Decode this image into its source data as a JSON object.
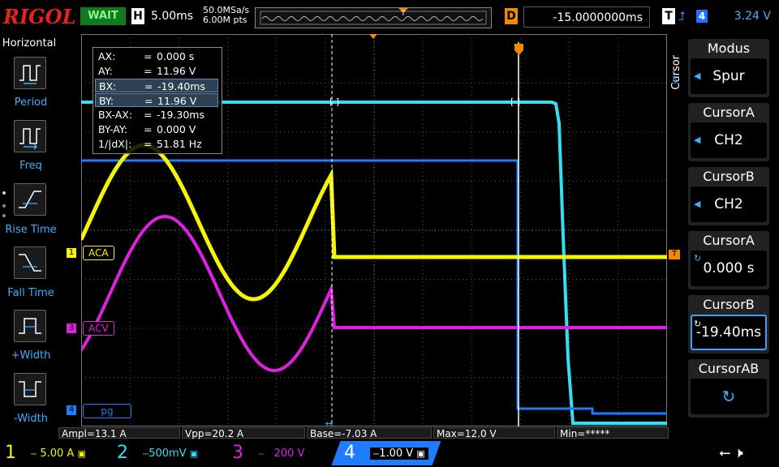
{
  "header": {
    "logo": "RIGOL",
    "run_state": "WAIT",
    "h_label": "H",
    "h_timebase": "5.00ms",
    "sample_rate": "50.0MSa/s",
    "memory_depth": "6.00M pts",
    "d_label": "D",
    "delay": "-15.0000000ms",
    "t_label": "T",
    "trigger_source": "4",
    "trigger_level": "3.24 V"
  },
  "left_menu": {
    "title": "Horizontal",
    "items": [
      {
        "label": "Period"
      },
      {
        "label": "Freq"
      },
      {
        "label": "Rise Time"
      },
      {
        "label": "Fall Time"
      },
      {
        "label": "+Width"
      },
      {
        "label": "-Width"
      }
    ]
  },
  "cursor_info": {
    "rows": [
      {
        "k": "AX:",
        "v": "0.000 s",
        "hl": false
      },
      {
        "k": "AY:",
        "v": "11.96 V",
        "hl": false
      },
      {
        "k": "BX:",
        "v": "-19.40ms",
        "hl": true
      },
      {
        "k": "BY:",
        "v": "11.96 V",
        "hl": true
      },
      {
        "k": "BX-AX:",
        "v": "-19.30ms",
        "hl": false
      },
      {
        "k": "BY-AY:",
        "v": "0.000 V",
        "hl": false
      },
      {
        "k": "1/|dX|:",
        "v": "51.81 Hz",
        "hl": false
      }
    ],
    "eq": "="
  },
  "channel_labels": {
    "ch1": {
      "num": "1",
      "name": "ACA"
    },
    "ch3": {
      "num": "3",
      "name": "ACV"
    },
    "ch4": {
      "num": "4",
      "name": "pg"
    },
    "trigger_marker": "T"
  },
  "right_menu": {
    "side_title": "Cursor",
    "boxes": [
      {
        "title": "Modus",
        "value": "Spur"
      },
      {
        "title": "CursorA",
        "value": "CH2"
      },
      {
        "title": "CursorB",
        "value": "CH2"
      },
      {
        "title": "CursorA",
        "value": "0.000 s"
      },
      {
        "title": "CursorB",
        "value": "-19.40ms"
      },
      {
        "title": "CursorAB",
        "value": ""
      }
    ]
  },
  "measurements": [
    "Ampl=13.1 A",
    "Vpp=20.2 A",
    "Base=-7.03 A",
    "Max=12.0 V",
    "Min=*****"
  ],
  "channels": [
    {
      "num": "1",
      "scale": "5.00 A",
      "color": "#f5f500"
    },
    {
      "num": "2",
      "scale": "500mV",
      "color": "#33e0f0"
    },
    {
      "num": "3",
      "scale": "200 V",
      "color": "#e020e0"
    },
    {
      "num": "4",
      "scale": "1.00 V",
      "color": "#1e7cff"
    }
  ],
  "colors": {
    "ch1": "#f5f500",
    "ch2": "#33e0f0",
    "ch3": "#e020e0",
    "ch4": "#1e7cff",
    "accent": "#f18a00"
  }
}
